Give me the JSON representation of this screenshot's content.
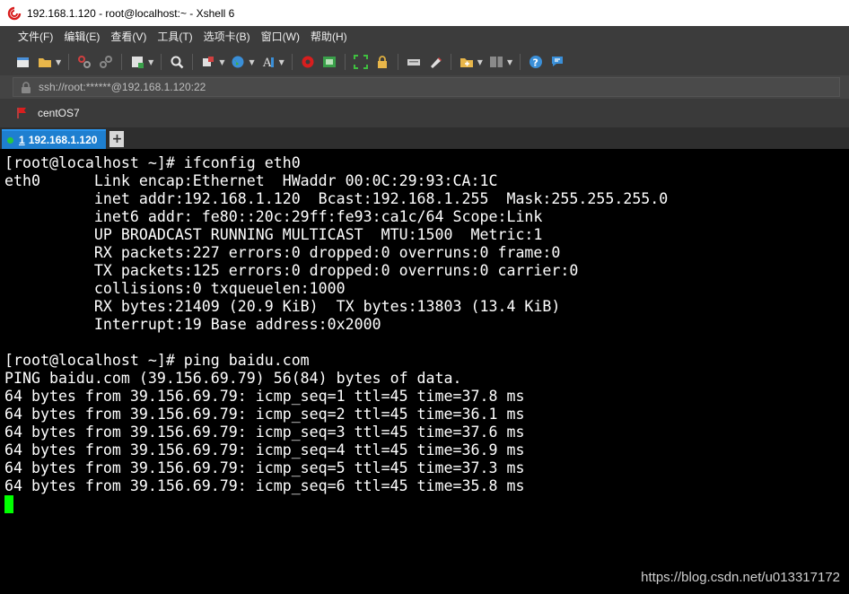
{
  "window": {
    "title": "192.168.1.120 - root@localhost:~ - Xshell 6"
  },
  "menu": {
    "items": [
      "文件(F)",
      "编辑(E)",
      "查看(V)",
      "工具(T)",
      "选项卡(B)",
      "窗口(W)",
      "帮助(H)"
    ]
  },
  "address": {
    "text": "ssh://root:******@192.168.1.120:22"
  },
  "session": {
    "label": "centOS7"
  },
  "tab": {
    "number": "1",
    "label": "192.168.1.120",
    "add": "+"
  },
  "terminal": {
    "lines": [
      "[root@localhost ~]# ifconfig eth0",
      "eth0      Link encap:Ethernet  HWaddr 00:0C:29:93:CA:1C  ",
      "          inet addr:192.168.1.120  Bcast:192.168.1.255  Mask:255.255.255.0",
      "          inet6 addr: fe80::20c:29ff:fe93:ca1c/64 Scope:Link",
      "          UP BROADCAST RUNNING MULTICAST  MTU:1500  Metric:1",
      "          RX packets:227 errors:0 dropped:0 overruns:0 frame:0",
      "          TX packets:125 errors:0 dropped:0 overruns:0 carrier:0",
      "          collisions:0 txqueuelen:1000 ",
      "          RX bytes:21409 (20.9 KiB)  TX bytes:13803 (13.4 KiB)",
      "          Interrupt:19 Base address:0x2000 ",
      "",
      "[root@localhost ~]# ping baidu.com",
      "PING baidu.com (39.156.69.79) 56(84) bytes of data.",
      "64 bytes from 39.156.69.79: icmp_seq=1 ttl=45 time=37.8 ms",
      "64 bytes from 39.156.69.79: icmp_seq=2 ttl=45 time=36.1 ms",
      "64 bytes from 39.156.69.79: icmp_seq=3 ttl=45 time=37.6 ms",
      "64 bytes from 39.156.69.79: icmp_seq=4 ttl=45 time=36.9 ms",
      "64 bytes from 39.156.69.79: icmp_seq=5 ttl=45 time=37.3 ms",
      "64 bytes from 39.156.69.79: icmp_seq=6 ttl=45 time=35.8 ms"
    ],
    "cursor_color": "#00ff00"
  },
  "watermark": "https://blog.csdn.net/u013317172",
  "colors": {
    "accent": "#1e7fd0",
    "chrome": "#3c3c3c",
    "terminal_bg": "#000000"
  }
}
